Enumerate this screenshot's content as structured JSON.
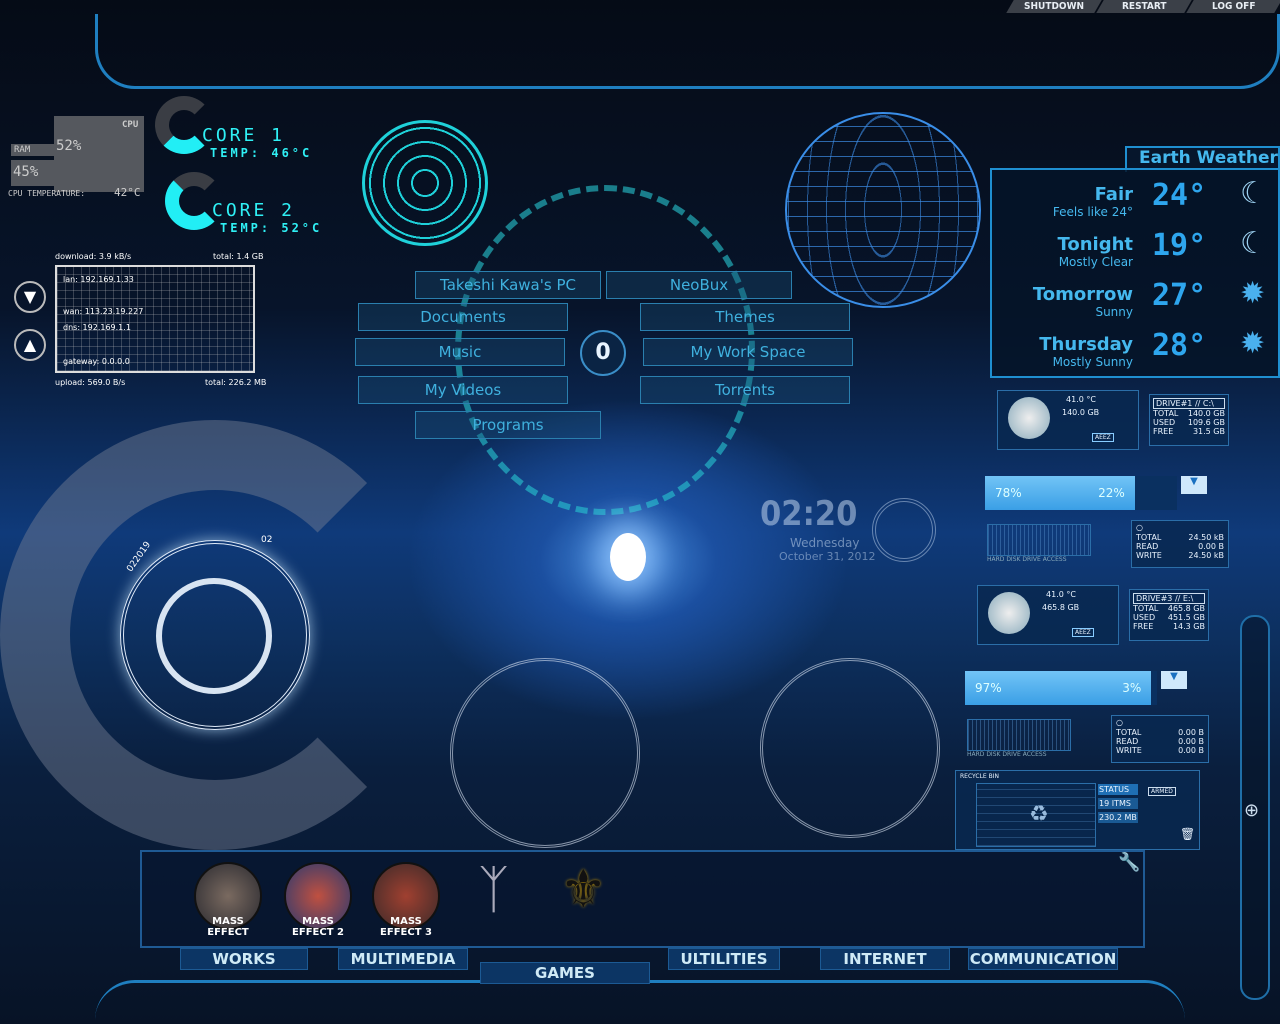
{
  "top_buttons": [
    "SHUTDOWN",
    "RESTART",
    "LOG OFF"
  ],
  "cpu": {
    "label": "CPU",
    "ram_label": "RAM",
    "cpu_pct": "52%",
    "ram_pct": "45%",
    "temp_label": "CPU TEMPERATURE:",
    "temp": "42°C"
  },
  "cores": [
    {
      "name": "CORE 1",
      "temp": "TEMP: 46°C"
    },
    {
      "name": "CORE 2",
      "temp": "TEMP: 52°C"
    }
  ],
  "network": {
    "download": "download: 3.9 kB/s",
    "download_total": "total: 1.4 GB",
    "lan": "lan: 192.169.1.33",
    "wan": "wan: 113.23.19.227",
    "dns": "dns: 192.169.1.1",
    "gateway": "gateway: 0.0.0.0",
    "upload": "upload: 569.0 B/s",
    "upload_total": "total: 226.2 MB"
  },
  "menu": {
    "left": [
      "Takeshi Kawa's PC",
      "Documents",
      "Music",
      "My Videos",
      "Programs"
    ],
    "right": [
      "NeoBux",
      "Themes",
      "My Work Space",
      "Torrents"
    ]
  },
  "clock": {
    "time": "02:20",
    "day": "Wednesday",
    "date": "October 31, 2012"
  },
  "dial": {
    "left_label": "022019",
    "right_label": "02"
  },
  "weather": {
    "title": "Earth Weather",
    "rows": [
      {
        "a": "Fair",
        "b": "Feels like 24°",
        "temp": "24°",
        "icon": "moon-cloud"
      },
      {
        "a": "Tonight",
        "b": "Mostly Clear",
        "temp": "19°",
        "icon": "moon-cloud"
      },
      {
        "a": "Tomorrow",
        "b": "Sunny",
        "temp": "27°",
        "icon": "sun"
      },
      {
        "a": "Thursday",
        "b": "Mostly Sunny",
        "temp": "28°",
        "icon": "sun-cloud"
      }
    ]
  },
  "drives": [
    {
      "name": "DRIVE#1 // C:\\",
      "temp": "41.0 °C",
      "size": "140.0 GB",
      "total": "140.0 GB",
      "used": "109.6 GB",
      "free": "31.5 GB",
      "used_pct": "78%",
      "free_pct": "22%",
      "used_fraction": 0.78,
      "access_label": "HARD DISK DRIVE ACCESS",
      "io_total": "24.50 kB",
      "io_read": "0.00 B",
      "io_write": "24.50 kB"
    },
    {
      "name": "DRIVE#3 // E:\\",
      "temp": "41.0 °C",
      "size": "465.8 GB",
      "total": "465.8 GB",
      "used": "451.5 GB",
      "free": "14.3 GB",
      "used_pct": "97%",
      "free_pct": "3%",
      "used_fraction": 0.97,
      "access_label": "HARD DISK DRIVE ACCESS",
      "io_total": "0.00 B",
      "io_read": "0.00 B",
      "io_write": "0.00 B"
    }
  ],
  "drive_labels": {
    "total": "TOTAL",
    "used": "USED",
    "free": "FREE",
    "read": "READ",
    "write": "WRITE",
    "badge": "AEEZ"
  },
  "recycle": {
    "title": "RECYCLE BIN",
    "status": "STATUS",
    "items": "19 ITMS",
    "size": "230.2 MB",
    "armed": "ARMED"
  },
  "dock": {
    "tabs": [
      "WORKS",
      "MULTIMEDIA",
      "GAMES",
      "ULTILITIES",
      "INTERNET",
      "COMMUNICATION"
    ],
    "games": [
      "MASS EFFECT",
      "MASS EFFECT 2",
      "MASS EFFECT 3",
      "Skyrim",
      "Emblem"
    ]
  },
  "colors": {
    "accent": "#2ff0f5",
    "frame": "#1f7fc0",
    "text": "#45b8ee"
  }
}
